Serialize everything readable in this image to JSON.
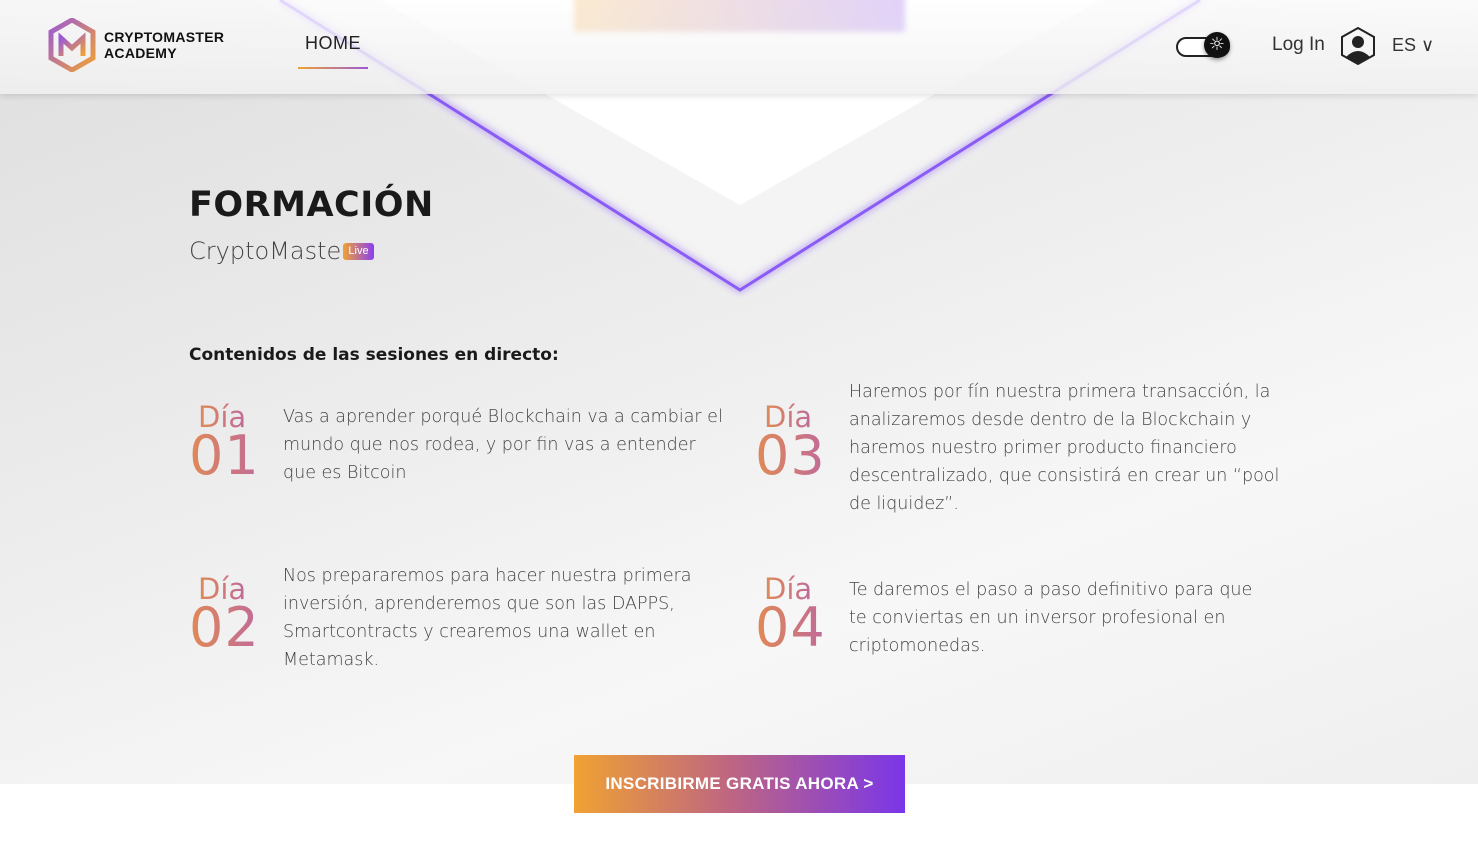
{
  "header": {
    "logo_line1": "CRYPTOMASTER",
    "logo_line2": "ACADEMY",
    "nav_home": "HOME",
    "login": "Log In",
    "language": "ES ∨"
  },
  "hero": {
    "title": "FORMACIÓN",
    "subtitle": "CryptoMaster",
    "badge": "Live"
  },
  "sessions": {
    "heading": "Contenidos de las sesiones en directo:",
    "day_label": "Día",
    "items": [
      {
        "number": "01",
        "text": "Vas a aprender porqué Blockchain va a cambiar el mundo que nos rodea, y por fin vas a entender que es Bitcoin"
      },
      {
        "number": "02",
        "text": "Nos prepararemos para hacer nuestra primera inversión, aprenderemos que son las DAPPS, Smartcontracts y crearemos una wallet en Metamask."
      },
      {
        "number": "03",
        "text": "Haremos por fín nuestra primera transacción, la analizaremos desde dentro de la Blockchain y haremos nuestro primer producto financiero descentralizado, que consistirá en crear un “pool de liquidez”."
      },
      {
        "number": "04",
        "text": "Te daremos el paso a paso definitivo para que te conviertas en un inversor profesional en criptomonedas."
      }
    ]
  },
  "cta": {
    "label": "INSCRIBIRME GRATIS AHORA >"
  },
  "colors": {
    "accent_orange": "#f0a233",
    "accent_purple": "#7a36e8"
  }
}
